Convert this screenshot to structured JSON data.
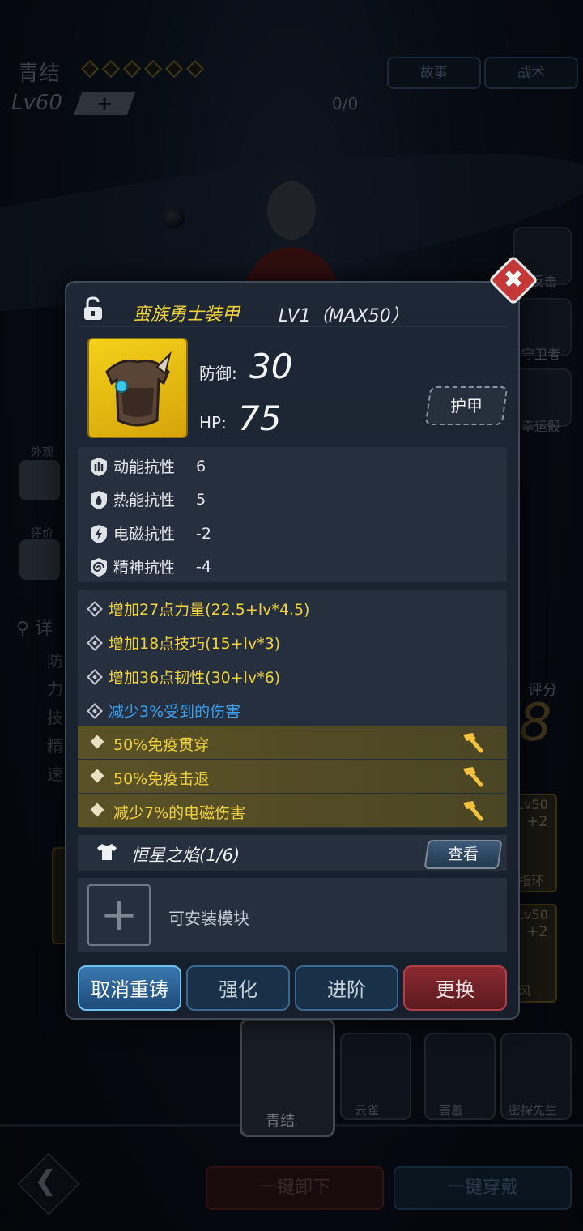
{
  "background": {
    "hero_name": "青结",
    "hero_level": "Lv60",
    "level_plus": "+",
    "exp_count": "0/0",
    "top_buttons": [
      "故事",
      "战术"
    ],
    "side_items": [
      "反击",
      "守卫者",
      "幸运骰"
    ],
    "left_labels": [
      "外观",
      "评价"
    ],
    "detail_label": "详",
    "attr_labels": [
      "防",
      "力",
      "技",
      "精",
      "速"
    ],
    "score_label": "评分",
    "score_value": "28",
    "equip_slots": [
      {
        "level": "Lv50",
        "plus": "+2",
        "label": "指环"
      },
      {
        "level": "Lv50",
        "plus": "+2",
        "label": "风"
      }
    ],
    "characters": [
      "青结",
      "云雀",
      "害羞",
      "密探先生"
    ],
    "bottom_buttons": [
      "一键卸下",
      "一键穿戴"
    ]
  },
  "modal": {
    "item_name": "蛮族勇士装甲",
    "item_level": "LV1（MAX50）",
    "defense_label": "防御:",
    "defense_value": "30",
    "hp_label": "HP:",
    "hp_value": "75",
    "type_badge": "护甲",
    "resistances": [
      {
        "label": "动能抗性",
        "value": "6",
        "icon": "kinetic-icon"
      },
      {
        "label": "热能抗性",
        "value": "5",
        "icon": "fire-icon"
      },
      {
        "label": "电磁抗性",
        "value": "-2",
        "icon": "lightning-icon"
      },
      {
        "label": "精神抗性",
        "value": "-4",
        "icon": "spiral-icon"
      }
    ],
    "bonuses": [
      {
        "text": "增加27点力量(22.5+lv*4.5)"
      },
      {
        "text": "增加18点技巧(15+lv*3)"
      },
      {
        "text": "增加36点韧性(30+lv*6)"
      },
      {
        "text": "减少3%受到的伤害"
      }
    ],
    "reforged": [
      {
        "text": "50%免疫贯穿"
      },
      {
        "text": "50%免疫击退"
      },
      {
        "text": "减少7%的电磁伤害"
      }
    ],
    "set_name": "恒星之焰(1/6)",
    "view_button": "查看",
    "module_text": "可安装模块",
    "actions": [
      "取消重铸",
      "强化",
      "进阶",
      "更换"
    ]
  },
  "colors": {
    "item_name": "#f2d23c",
    "bonus_blue": "#3aa0f0",
    "close_red": "#c43838"
  }
}
